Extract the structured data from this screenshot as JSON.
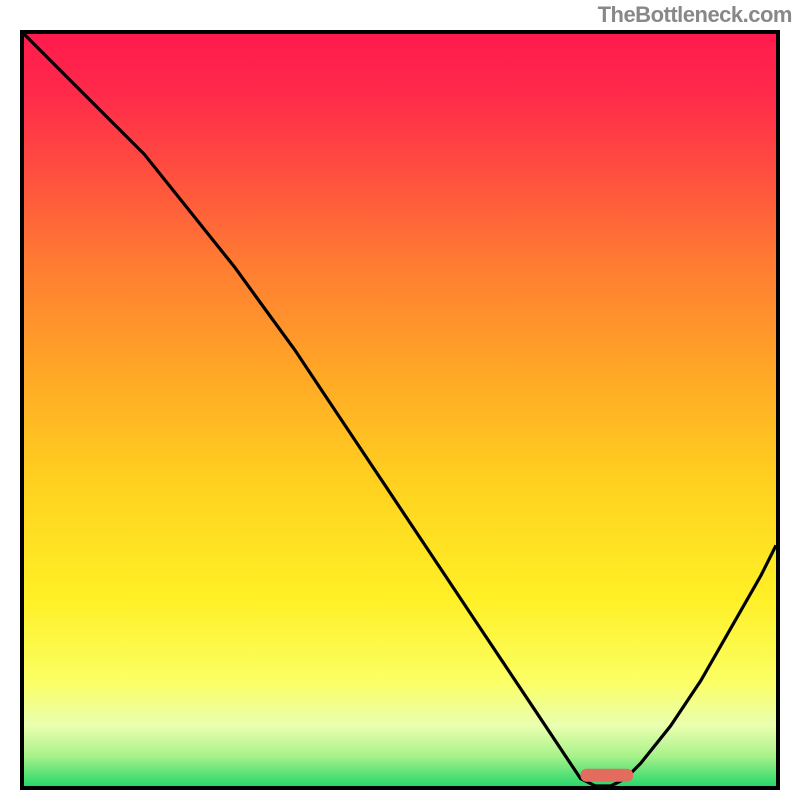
{
  "watermark": "TheBottleneck.com",
  "colors": {
    "curve": "#000000",
    "marker": "#e46c5e",
    "border": "#000000",
    "gradient": [
      "#ff1a4d",
      "#ff4d40",
      "#ff9d29",
      "#ffd21f",
      "#fbff63",
      "#a8f28a",
      "#28d76a"
    ]
  },
  "chart_data": {
    "type": "line",
    "title": "",
    "xlabel": "",
    "ylabel": "",
    "xlim": [
      0,
      100
    ],
    "ylim": [
      0,
      100
    ],
    "annotations": [
      {
        "name": "optimal-range",
        "x_start": 74,
        "x_end": 81,
        "y": 1.5
      }
    ],
    "series": [
      {
        "name": "bottleneck-curve",
        "x": [
          0,
          4,
          8,
          12,
          16,
          20,
          24,
          28,
          32,
          36,
          40,
          44,
          48,
          52,
          56,
          60,
          64,
          68,
          72,
          74,
          76,
          78,
          80,
          82,
          86,
          90,
          94,
          98,
          100
        ],
        "y": [
          100,
          96,
          92,
          88,
          84,
          79,
          74,
          69,
          63.5,
          58,
          52,
          46,
          40,
          34,
          28,
          22,
          16,
          10,
          4,
          1,
          0,
          0,
          1,
          3,
          8,
          14,
          21,
          28,
          32
        ]
      }
    ]
  }
}
